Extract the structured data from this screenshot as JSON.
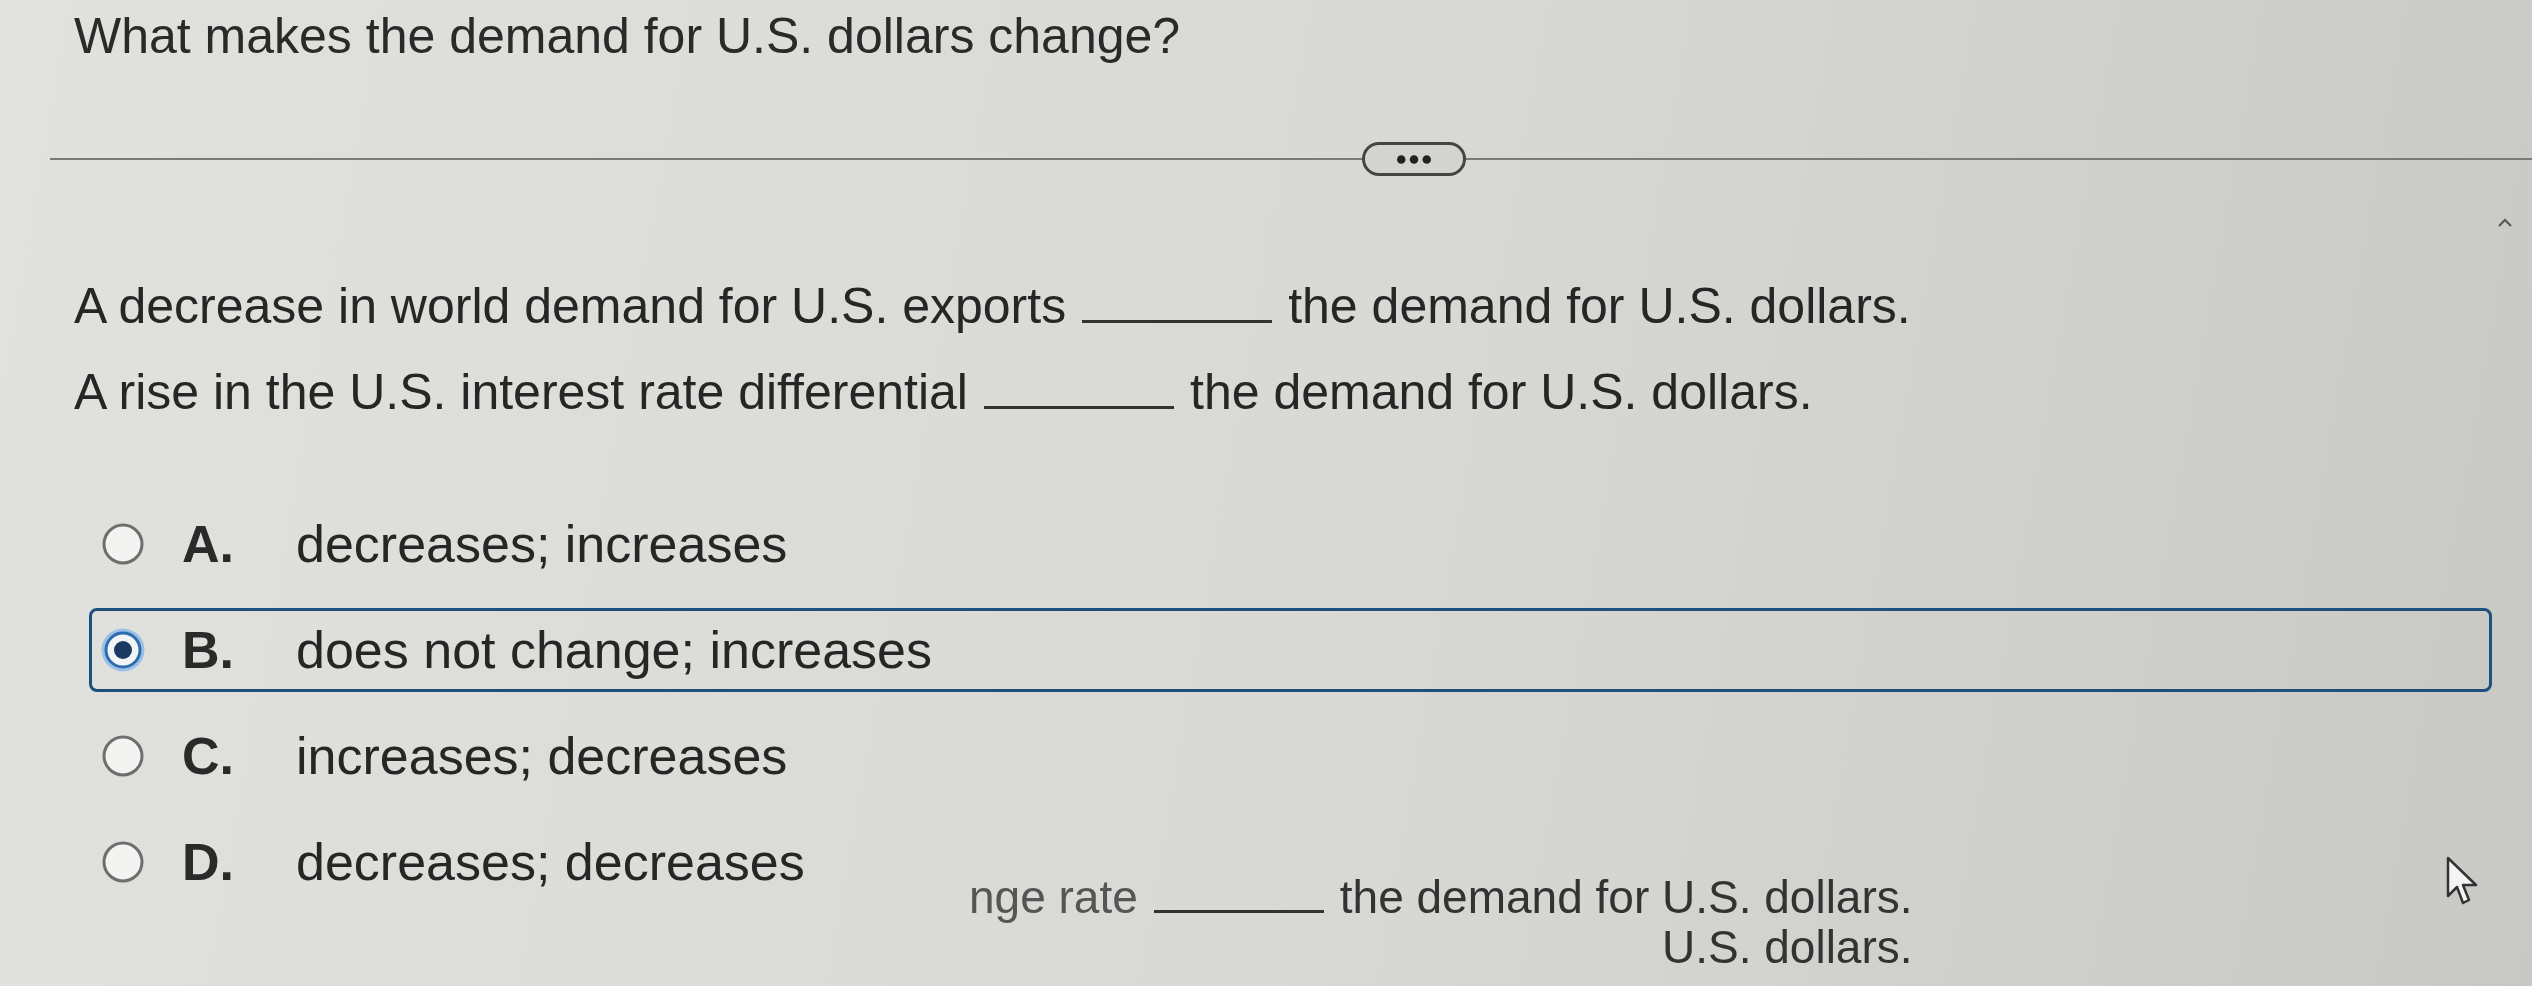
{
  "question": {
    "title": "What makes the demand for U.S. dollars change?"
  },
  "statements": [
    {
      "before": "A decrease in world demand for U.S. exports",
      "after": "the demand for U.S. dollars."
    },
    {
      "before": "A rise in the U.S. interest rate differential",
      "after": "the demand for U.S. dollars."
    }
  ],
  "options": [
    {
      "letter": "A.",
      "text": "decreases; increases",
      "selected": false
    },
    {
      "letter": "B.",
      "text": "does not change; increases",
      "selected": true
    },
    {
      "letter": "C.",
      "text": "increases; decreases",
      "selected": false
    },
    {
      "letter": "D.",
      "text": "decreases; decreases",
      "selected": false
    }
  ],
  "next_statements": [
    {
      "before": "nge rate",
      "after": "the demand for U.S. dollars."
    },
    {
      "after": "U.S. dollars."
    }
  ]
}
